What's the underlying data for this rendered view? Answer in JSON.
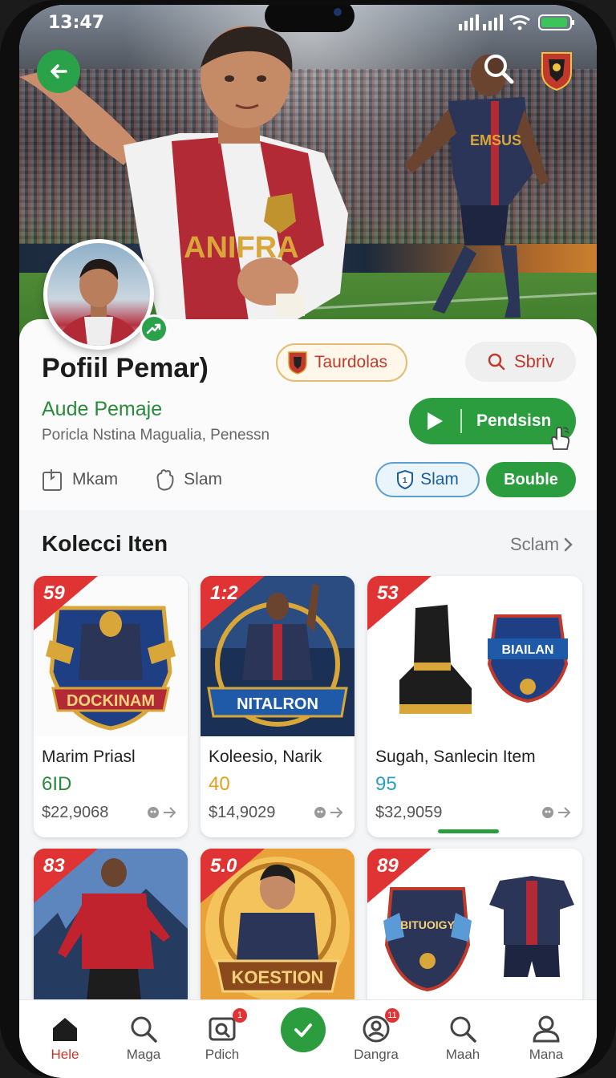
{
  "status_bar": {
    "time": "13:47"
  },
  "profile": {
    "title": "Pofiil Pemar)",
    "team_chip": "Taurdolas",
    "search_label": "Sbriv",
    "subname": "Aude Pemaje",
    "description": "Poricla Nstina Magualia, Penessn",
    "play_label": "Pendsisn",
    "meta": [
      {
        "label": "Mkam",
        "icon": "square-tag-icon"
      },
      {
        "label": "Slam",
        "icon": "hand-icon"
      }
    ],
    "slam_chip": "Slam",
    "bouble_chip": "Bouble"
  },
  "hero": {
    "jersey_text": "ANIFRA",
    "player2_text": "EMSUS"
  },
  "collection": {
    "title": "Kolecci Iten",
    "see_all": "Sclam",
    "items": [
      {
        "ribbon": "59",
        "art_text": "DOCKINAM",
        "name": "Marim Priasl",
        "score": "6ID",
        "score_color": "#2a8a3c",
        "price": "$22,9068"
      },
      {
        "ribbon": "1:2",
        "art_text": "NITALRON",
        "name": "Koleesio, Narik",
        "score": "40",
        "score_color": "#e0a020",
        "price": "$14,9029"
      },
      {
        "ribbon": "53",
        "art_text": "BIAILAN",
        "name": "Sugah, Sanlecin Item",
        "score": "95",
        "score_color": "#2aa0c0",
        "price": "$32,9059"
      },
      {
        "ribbon": "83",
        "art_text": "",
        "name": "",
        "score": "",
        "score_color": "#2a8a3c",
        "price": ""
      },
      {
        "ribbon": "5.0",
        "art_text": "KOESTION",
        "name": "",
        "score": "",
        "score_color": "#2a8a3c",
        "price": ""
      },
      {
        "ribbon": "89",
        "art_text": "BITUOIGY",
        "name": "",
        "score": "",
        "score_color": "#2a8a3c",
        "price": ""
      }
    ]
  },
  "nav": {
    "items": [
      {
        "label": "Hele",
        "icon": "home-icon",
        "active": true
      },
      {
        "label": "Maga",
        "icon": "search-icon",
        "active": false
      },
      {
        "label": "Pdich",
        "icon": "camera-search-icon",
        "badge": "1",
        "active": false
      },
      {
        "label": "Dangra",
        "icon": "user-circle-icon",
        "badge": "11",
        "active": false
      },
      {
        "label": "Maah",
        "icon": "search-icon",
        "active": false
      },
      {
        "label": "Mana",
        "icon": "user-icon",
        "active": false
      }
    ]
  },
  "colors": {
    "accent_green": "#2b9d3f",
    "accent_red": "#e03434",
    "link_red": "#c0392b"
  }
}
